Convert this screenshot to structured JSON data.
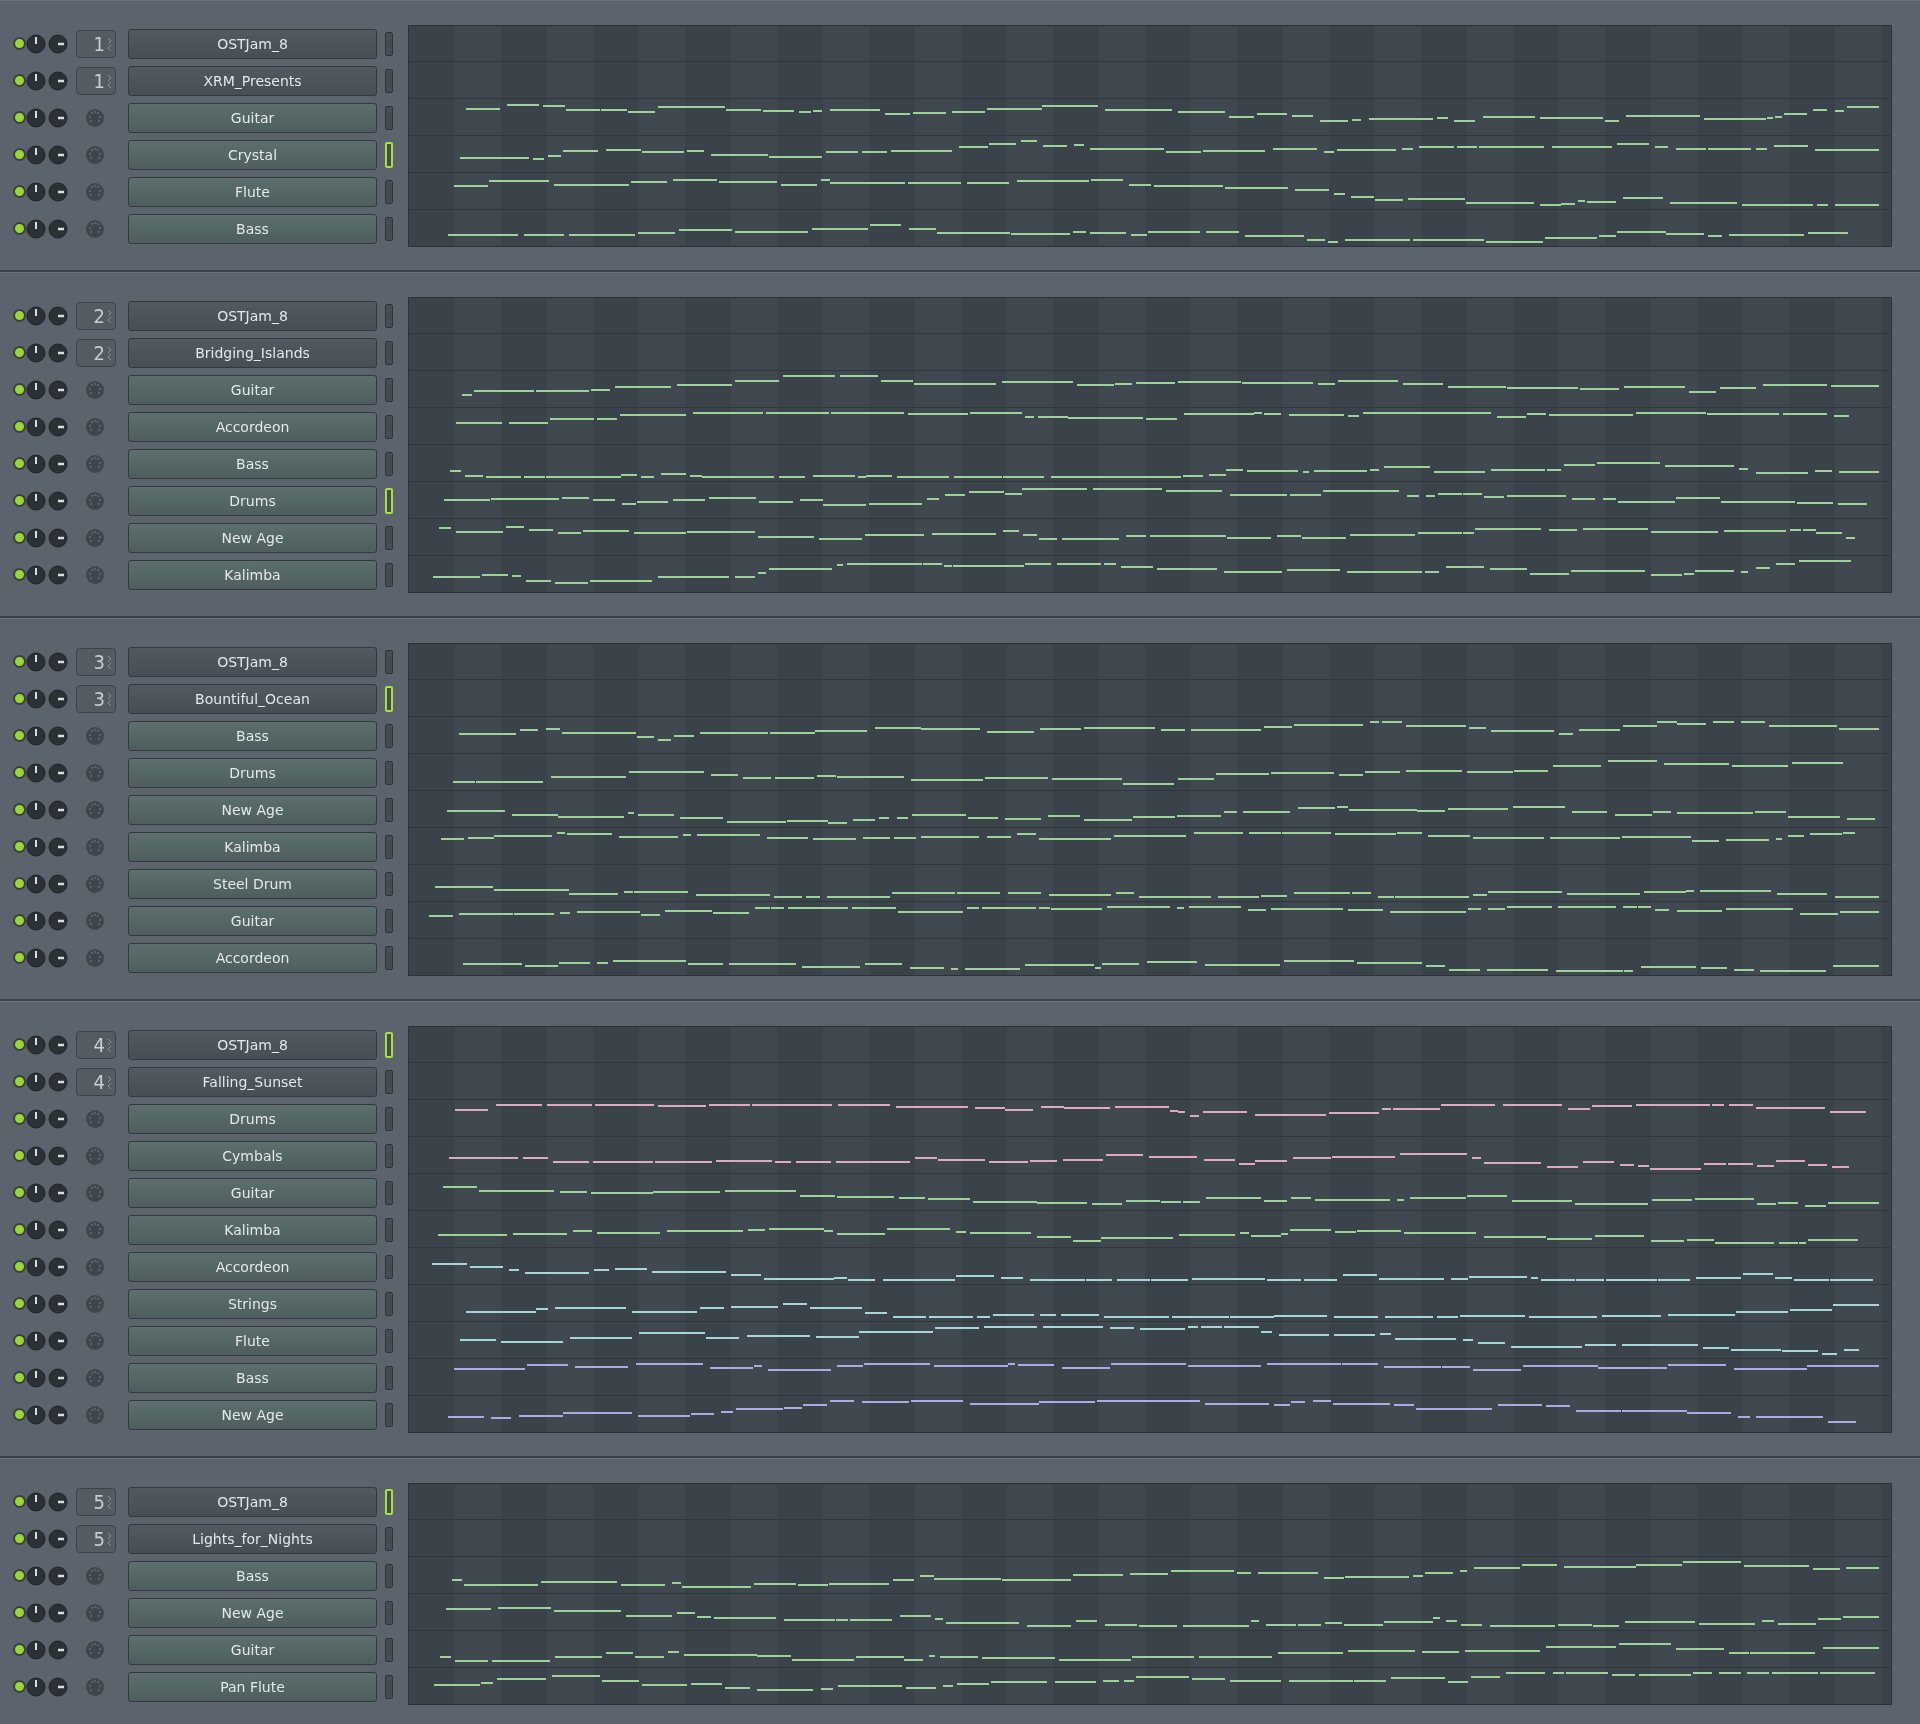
{
  "sections": [
    {
      "rows": [
        {
          "kind": "pattern",
          "number": "1",
          "name": "OSTJam_8",
          "selected": false
        },
        {
          "kind": "pattern",
          "number": "1",
          "name": "XRM_Presents",
          "selected": false
        },
        {
          "kind": "channel",
          "name": "Guitar",
          "selected": false,
          "color": "#9fd29a"
        },
        {
          "kind": "channel",
          "name": "Crystal",
          "selected": true,
          "color": "#9fd29a"
        },
        {
          "kind": "channel",
          "name": "Flute",
          "selected": false,
          "color": "#9fd29a"
        },
        {
          "kind": "channel",
          "name": "Bass",
          "selected": false,
          "color": "#9fd29a"
        }
      ]
    },
    {
      "rows": [
        {
          "kind": "pattern",
          "number": "2",
          "name": "OSTJam_8",
          "selected": false
        },
        {
          "kind": "pattern",
          "number": "2",
          "name": "Bridging_Islands",
          "selected": false
        },
        {
          "kind": "channel",
          "name": "Guitar",
          "selected": false,
          "color": "#9fd29a"
        },
        {
          "kind": "channel",
          "name": "Accordeon",
          "selected": false,
          "color": "#9fd29a"
        },
        {
          "kind": "channel",
          "name": "Bass",
          "selected": false,
          "color": "#9fd29a"
        },
        {
          "kind": "channel",
          "name": "Drums",
          "selected": true,
          "color": "#9fd29a"
        },
        {
          "kind": "channel",
          "name": "New Age",
          "selected": false,
          "color": "#9fd29a"
        },
        {
          "kind": "channel",
          "name": "Kalimba",
          "selected": false,
          "color": "#9fd29a"
        }
      ]
    },
    {
      "rows": [
        {
          "kind": "pattern",
          "number": "3",
          "name": "OSTJam_8",
          "selected": false
        },
        {
          "kind": "pattern",
          "number": "3",
          "name": "Bountiful_Ocean",
          "selected": true
        },
        {
          "kind": "channel",
          "name": "Bass",
          "selected": false,
          "color": "#9fd29a"
        },
        {
          "kind": "channel",
          "name": "Drums",
          "selected": false,
          "color": "#9fd29a"
        },
        {
          "kind": "channel",
          "name": "New Age",
          "selected": false,
          "color": "#9fd29a"
        },
        {
          "kind": "channel",
          "name": "Kalimba",
          "selected": false,
          "color": "#9fd29a"
        },
        {
          "kind": "channel",
          "name": "Steel Drum",
          "selected": false,
          "color": "#9fd29a"
        },
        {
          "kind": "channel",
          "name": "Guitar",
          "selected": false,
          "color": "#9fd29a"
        },
        {
          "kind": "channel",
          "name": "Accordeon",
          "selected": false,
          "color": "#9fd29a"
        }
      ]
    },
    {
      "rows": [
        {
          "kind": "pattern",
          "number": "4",
          "name": "OSTJam_8",
          "selected": true
        },
        {
          "kind": "pattern",
          "number": "4",
          "name": "Falling_Sunset",
          "selected": false
        },
        {
          "kind": "channel",
          "name": "Drums",
          "selected": false,
          "color": "#e0a8c8"
        },
        {
          "kind": "channel",
          "name": "Cymbals",
          "selected": false,
          "color": "#e0a8c8"
        },
        {
          "kind": "channel",
          "name": "Guitar",
          "selected": false,
          "color": "#9fd29a"
        },
        {
          "kind": "channel",
          "name": "Kalimba",
          "selected": false,
          "color": "#9fd29a"
        },
        {
          "kind": "channel",
          "name": "Accordeon",
          "selected": false,
          "color": "#a8d4dc"
        },
        {
          "kind": "channel",
          "name": "Strings",
          "selected": false,
          "color": "#a8d4dc"
        },
        {
          "kind": "channel",
          "name": "Flute",
          "selected": false,
          "color": "#a8d4dc"
        },
        {
          "kind": "channel",
          "name": "Bass",
          "selected": false,
          "color": "#b0a8e0"
        },
        {
          "kind": "channel",
          "name": "New Age",
          "selected": false,
          "color": "#b0a8e0"
        }
      ]
    },
    {
      "rows": [
        {
          "kind": "pattern",
          "number": "5",
          "name": "OSTJam_8",
          "selected": true
        },
        {
          "kind": "pattern",
          "number": "5",
          "name": "Lights_for_Nights",
          "selected": false
        },
        {
          "kind": "channel",
          "name": "Bass",
          "selected": false,
          "color": "#9fd29a"
        },
        {
          "kind": "channel",
          "name": "New Age",
          "selected": false,
          "color": "#9fd29a"
        },
        {
          "kind": "channel",
          "name": "Guitar",
          "selected": false,
          "color": "#9fd29a"
        },
        {
          "kind": "channel",
          "name": "Pan Flute",
          "selected": false,
          "color": "#9fd29a"
        }
      ]
    }
  ]
}
